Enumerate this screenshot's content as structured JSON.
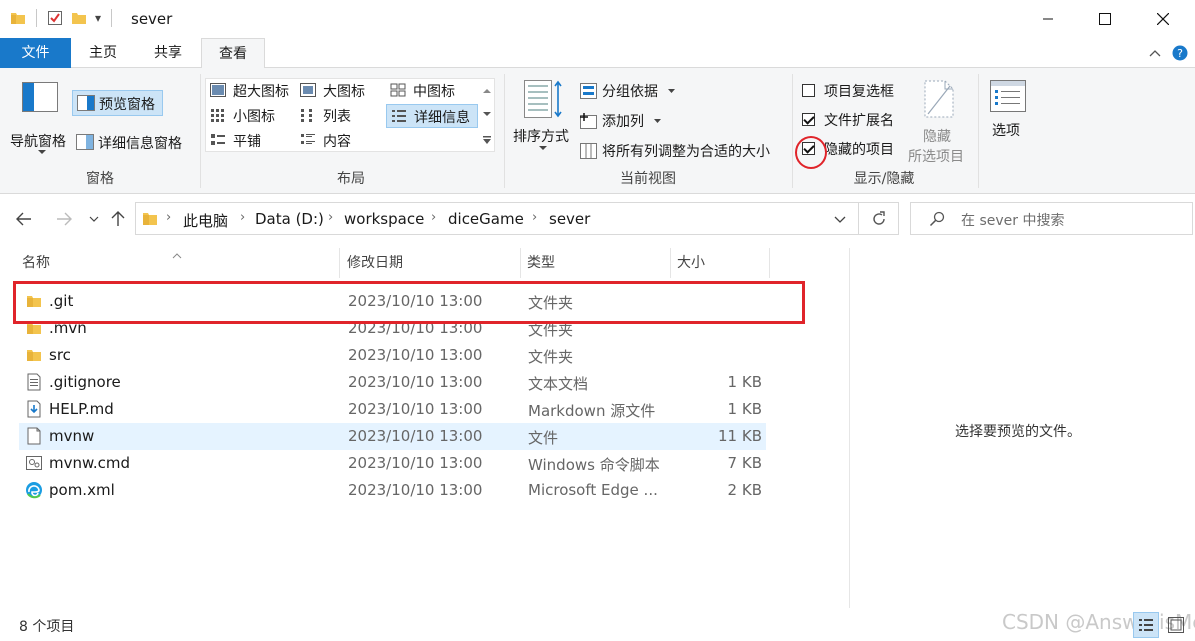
{
  "window": {
    "title": "sever",
    "quick_access_dropdown": "▾"
  },
  "tabs": [
    {
      "label": "文件"
    },
    {
      "label": "主页"
    },
    {
      "label": "共享"
    },
    {
      "label": "查看"
    }
  ],
  "ribbon": {
    "panes": {
      "nav_pane": "导航窗格",
      "preview_pane": "预览窗格",
      "details_pane": "详细信息窗格",
      "group_label": "窗格"
    },
    "layout": {
      "items": [
        {
          "label": "超大图标"
        },
        {
          "label": "大图标"
        },
        {
          "label": "中图标"
        },
        {
          "label": "小图标"
        },
        {
          "label": "列表"
        },
        {
          "label": "详细信息"
        },
        {
          "label": "平铺"
        },
        {
          "label": "内容"
        }
      ],
      "group_label": "布局"
    },
    "current_view": {
      "sort_by": "排序方式",
      "group_by": "分组依据",
      "add_column": "添加列",
      "fit_columns": "将所有列调整为合适的大小",
      "group_label": "当前视图"
    },
    "show_hide": {
      "item_checkboxes": {
        "label": "项目复选框",
        "checked": false
      },
      "file_extensions": {
        "label": "文件扩展名",
        "checked": true
      },
      "hidden_items": {
        "label": "隐藏的项目",
        "checked": true
      },
      "hide_selected_line1": "隐藏",
      "hide_selected_line2": "所选项目",
      "group_label": "显示/隐藏"
    },
    "options": {
      "label": "选项"
    }
  },
  "address": {
    "crumbs": [
      "此电脑",
      "Data (D:)",
      "workspace",
      "diceGame",
      "sever"
    ],
    "search_placeholder": "在 sever 中搜索"
  },
  "columns": {
    "name": "名称",
    "date": "修改日期",
    "type": "类型",
    "size": "大小"
  },
  "files": [
    {
      "name": ".git",
      "date": "2023/10/10 13:00",
      "type": "文件夹",
      "size": "",
      "icon": "folder-icon"
    },
    {
      "name": ".mvn",
      "date": "2023/10/10 13:00",
      "type": "文件夹",
      "size": "",
      "icon": "folder-icon"
    },
    {
      "name": "src",
      "date": "2023/10/10 13:00",
      "type": "文件夹",
      "size": "",
      "icon": "folder-icon"
    },
    {
      "name": ".gitignore",
      "date": "2023/10/10 13:00",
      "type": "文本文档",
      "size": "1 KB",
      "icon": "text-file-icon"
    },
    {
      "name": "HELP.md",
      "date": "2023/10/10 13:00",
      "type": "Markdown 源文件",
      "size": "1 KB",
      "icon": "markdown-file-icon"
    },
    {
      "name": "mvnw",
      "date": "2023/10/10 13:00",
      "type": "文件",
      "size": "11 KB",
      "icon": "blank-file-icon"
    },
    {
      "name": "mvnw.cmd",
      "date": "2023/10/10 13:00",
      "type": "Windows 命令脚本",
      "size": "7 KB",
      "icon": "cmd-file-icon"
    },
    {
      "name": "pom.xml",
      "date": "2023/10/10 13:00",
      "type": "Microsoft Edge ...",
      "size": "2 KB",
      "icon": "edge-file-icon"
    }
  ],
  "preview": {
    "empty_text": "选择要预览的文件。"
  },
  "status": {
    "item_count": "8 个项目"
  },
  "watermark": "CSDN @AnswerisMe",
  "colors": {
    "accent": "#1979ca",
    "selection": "#cce4f7",
    "highlight_row": "#e5f3ff",
    "annotation_red": "#e0242a",
    "folder": "#f3c44e"
  }
}
